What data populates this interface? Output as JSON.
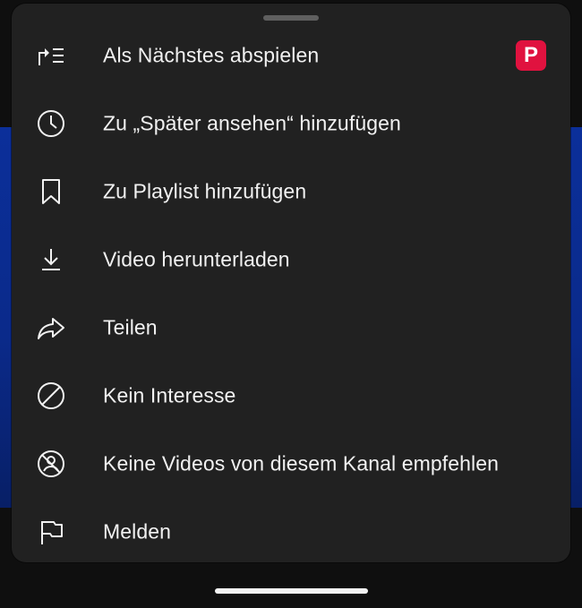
{
  "menu": {
    "items": [
      {
        "label": "Als Nächstes abspielen",
        "icon": "play-next-icon"
      },
      {
        "label": "Zu „Später ansehen“ hinzufügen",
        "icon": "clock-icon"
      },
      {
        "label": "Zu Playlist hinzufügen",
        "icon": "bookmark-icon"
      },
      {
        "label": "Video herunterladen",
        "icon": "download-icon"
      },
      {
        "label": "Teilen",
        "icon": "share-icon"
      },
      {
        "label": "Kein Interesse",
        "icon": "not-interested-icon"
      },
      {
        "label": "Keine Videos von diesem Kanal empfehlen",
        "icon": "block-channel-icon"
      },
      {
        "label": "Melden",
        "icon": "flag-icon"
      }
    ],
    "badge": {
      "text": "P",
      "color": "#e0123f"
    }
  },
  "colors": {
    "sheet_background": "#212121",
    "text": "#f1f1f1",
    "video_background": "#0b2f9a"
  }
}
